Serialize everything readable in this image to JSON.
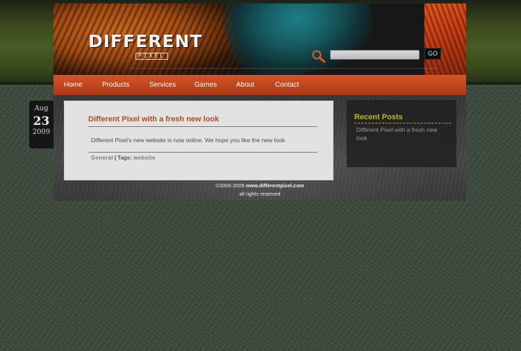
{
  "header": {
    "logo_text": "DIFFERENT",
    "logo_sub": "PIXEL",
    "search_placeholder": "",
    "go_label": "GO"
  },
  "nav": {
    "items": [
      {
        "label": "Home"
      },
      {
        "label": "Products"
      },
      {
        "label": "Services"
      },
      {
        "label": "Games"
      },
      {
        "label": "About"
      },
      {
        "label": "Contact"
      }
    ]
  },
  "post": {
    "date": {
      "month": "Aug",
      "day": "23",
      "year": "2009"
    },
    "title": "Different Pixel with a fresh new look",
    "body": "Different Pixel's new website is now online. We hope you like the new look.",
    "category": "General",
    "tags_label": "Tags:",
    "tag": "website"
  },
  "sidebar": {
    "title": "Recent Posts",
    "links": [
      "Different Pixel with a fresh new look"
    ]
  },
  "footer": {
    "copyright": "©2006-2009",
    "site": "www.differentpixel.com",
    "rights": "all rights reserved"
  },
  "colors": {
    "nav_bg": "#c1461f",
    "title_accent": "#b34a25",
    "sidebar_title": "#c2b42e",
    "page_bg": "#3d4a3c"
  }
}
